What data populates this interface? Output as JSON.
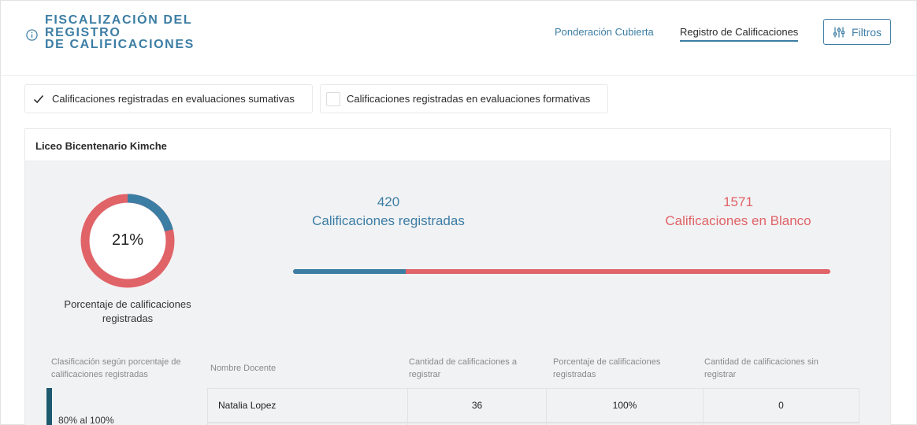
{
  "header": {
    "title_lines": [
      "FISCALIZACIÓN DEL",
      "REGISTRO",
      "DE CALIFICACIONES"
    ],
    "tabs": [
      {
        "label": "Ponderación Cubierta",
        "active": false
      },
      {
        "label": "Registro de Calificaciones",
        "active": true
      }
    ],
    "filter_label": "Filtros"
  },
  "checks": [
    {
      "label": "Calificaciones registradas en evaluaciones sumativas",
      "checked": true
    },
    {
      "label": "Calificaciones registradas en evaluaciones formativas",
      "checked": false
    }
  ],
  "school": {
    "name": "Liceo Bicentenario Kimche",
    "percent": 21,
    "percent_label": "21%",
    "percent_caption": "Porcentaje de calificaciones registradas",
    "registered": {
      "value": "420",
      "label": "Calificaciones registradas"
    },
    "blank": {
      "value": "1571",
      "label": "Calificaciones en Blanco"
    }
  },
  "colors": {
    "accent": "#3c7da4",
    "blank": "#e06367",
    "class_bar": "#1e5a6f"
  },
  "table": {
    "headers": [
      "Clasificación según porcentaje de calificaciones registradas",
      "Nombre Docente",
      "Cantidad de calificaciones a registrar",
      "Porcentaje de calificaciones registradas",
      "Cantidad de calificaciones sin registrar"
    ],
    "rows": [
      {
        "classification": "80% al 100%",
        "teacher": "Natalia Lopez",
        "to_register": "36",
        "percent": "100%",
        "unregistered": "0"
      }
    ]
  }
}
